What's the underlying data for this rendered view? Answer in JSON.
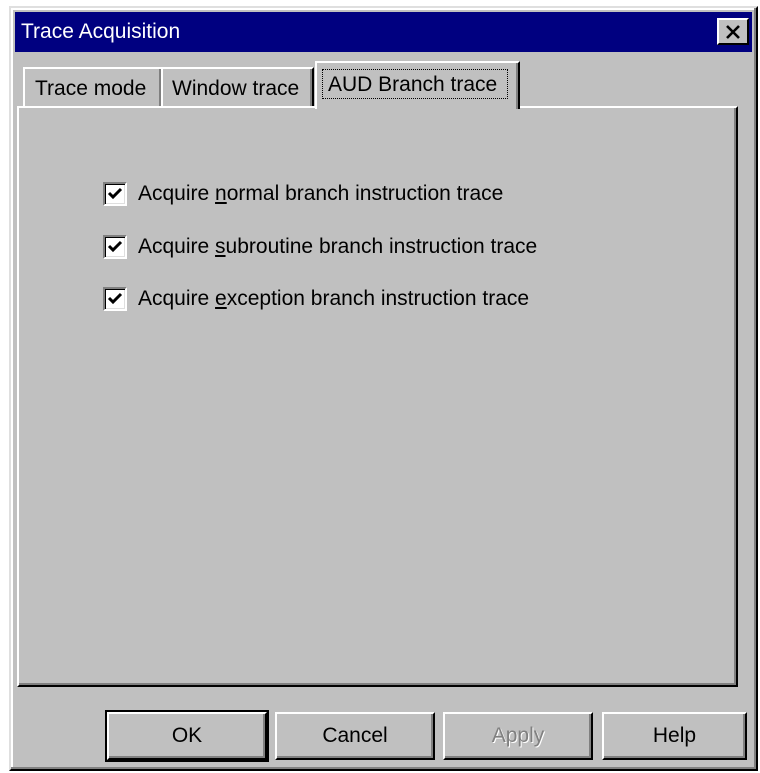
{
  "window": {
    "title": "Trace Acquisition"
  },
  "tabs": [
    {
      "label": "Trace mode",
      "active": false
    },
    {
      "label": "Window trace",
      "active": false
    },
    {
      "label": "AUD Branch trace",
      "active": true
    }
  ],
  "options": [
    {
      "prefix": "Acquire ",
      "mnemonic": "n",
      "suffix": "ormal branch instruction trace",
      "checked": true
    },
    {
      "prefix": "Acquire ",
      "mnemonic": "s",
      "suffix": "ubroutine branch instruction trace",
      "checked": true
    },
    {
      "prefix": "Acquire ",
      "mnemonic": "e",
      "suffix": "xception branch instruction trace",
      "checked": true
    }
  ],
  "buttons": {
    "ok": "OK",
    "cancel": "Cancel",
    "apply": "Apply",
    "help": "Help"
  },
  "icons": {
    "close": "close-icon",
    "check": "checkmark-icon"
  },
  "colors": {
    "face": "#c0c0c0",
    "titlebar": "#000080",
    "disabled_text": "#808080"
  }
}
